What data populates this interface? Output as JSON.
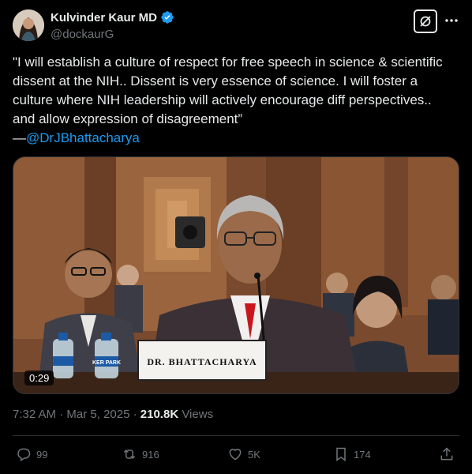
{
  "author": {
    "display_name": "Kulvinder Kaur MD",
    "handle": "@dockaurG",
    "verified": true,
    "avatar_icon": "profile-photo"
  },
  "header_actions": {
    "grok_icon": "grok-icon",
    "more_icon": "more-icon"
  },
  "tweet": {
    "lines": [
      "\"I will establish a culture of respect for free speech in science & scientific",
      "dissent at the NIH.. Dissent is very essence of science. I will foster a",
      "culture where NIH leadership will actively encourage diff perspectives..",
      "and allow expression of disagreement”"
    ],
    "attribution_prefix": "—",
    "mention": "@DrJBhattacharya"
  },
  "media": {
    "duration": "0:29",
    "nameplate": "DR. BHATTACHARYA",
    "bottle_label": "KER PARK"
  },
  "meta": {
    "time": "7:32 AM",
    "separator": " · ",
    "date": "Mar 5, 2025",
    "views_count": "210.8K",
    "views_label": " Views"
  },
  "actions": {
    "replies": "99",
    "reposts": "916",
    "likes": "5K",
    "bookmarks": "174"
  },
  "colors": {
    "background": "#000000",
    "text": "#e7e9ea",
    "muted": "#71767b",
    "link": "#1d9bf0",
    "divider": "#2f3336"
  }
}
